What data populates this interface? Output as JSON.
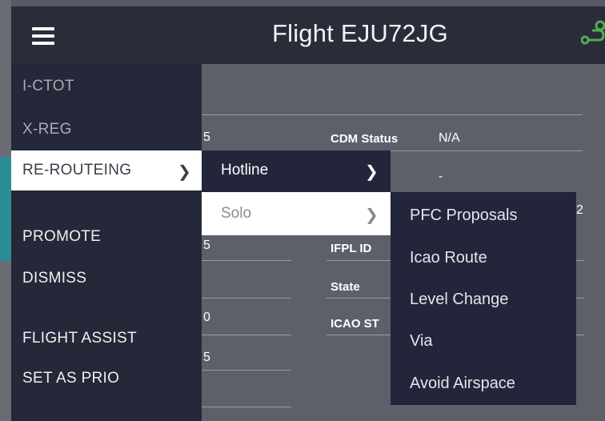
{
  "header": {
    "title": "Flight EJU72JG"
  },
  "background_form": {
    "cdm_status_label": "CDM Status",
    "cdm_status_value": "N/A",
    "dash_value": "-",
    "ifpl_id_label": "IFPL ID",
    "state_label": "State",
    "icao_st_label": "ICAO ST",
    "fragment_a": "5",
    "fragment_b": "5",
    "fragment_c": "0",
    "fragment_d": "5",
    "fragment_e": "2"
  },
  "main_menu": {
    "items": [
      {
        "label": "I-CTOT"
      },
      {
        "label": "X-REG"
      },
      {
        "label": "RE-ROUTEING"
      },
      {
        "label": "PROMOTE"
      },
      {
        "label": "DISMISS"
      },
      {
        "label": "FLIGHT ASSIST"
      },
      {
        "label": "SET AS PRIO"
      }
    ]
  },
  "submenu_reroute": {
    "items": [
      {
        "label": "Hotline"
      },
      {
        "label": "Solo"
      }
    ]
  },
  "submenu_solo": {
    "items": [
      {
        "label": "PFC Proposals"
      },
      {
        "label": "Icao Route"
      },
      {
        "label": "Level Change"
      },
      {
        "label": "Via"
      },
      {
        "label": "Avoid Airspace"
      }
    ]
  },
  "icons": {
    "hamburger": "menu-icon",
    "route": "route-icon",
    "chevron": "chevron-right-icon"
  },
  "colors": {
    "header_bg": "#2a2c39",
    "menu_bg": "#252838",
    "highlight_bg": "#ffffff",
    "accent_green": "#4caf50"
  }
}
